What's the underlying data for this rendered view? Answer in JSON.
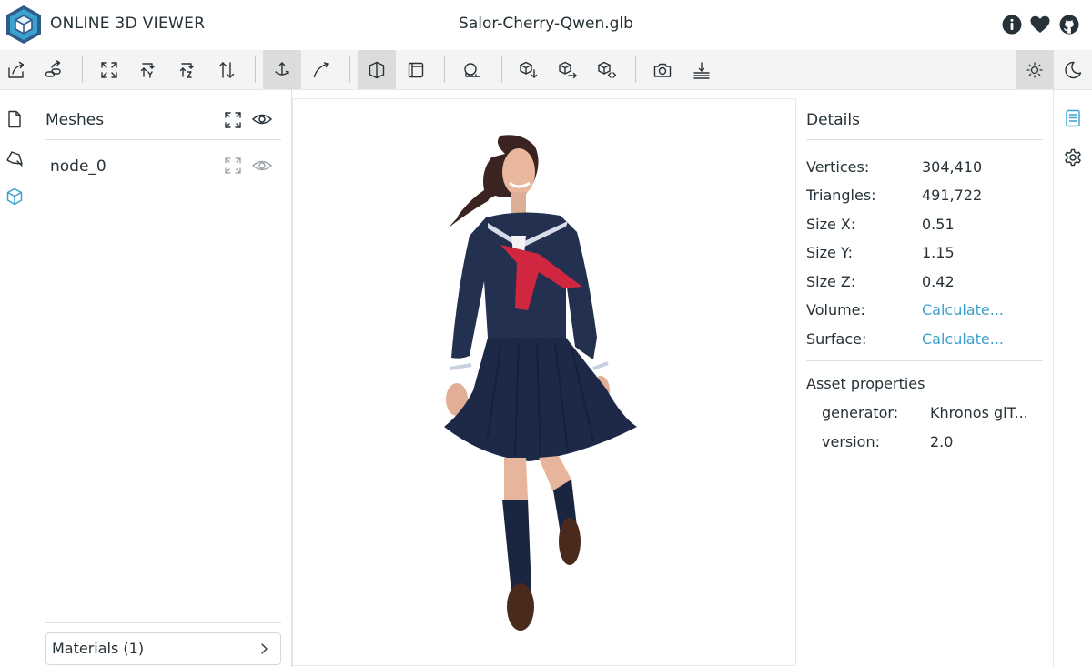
{
  "header": {
    "app_title": "ONLINE 3D VIEWER",
    "file_name": "Salor-Cherry-Qwen.glb",
    "icons": [
      "info-icon",
      "heart-icon",
      "github-icon"
    ]
  },
  "toolbar": {
    "buttons": [
      "open-file",
      "open-url",
      "fit-to-window",
      "set-up-y",
      "set-up-z",
      "flip-up",
      "fixed-up-navigation",
      "free-orbit-navigation",
      "perspective-camera",
      "orthographic-camera",
      "edge-display",
      "export",
      "share",
      "embed",
      "snapshot",
      "measure",
      "light-mode",
      "dark-mode"
    ],
    "selected": [
      "fixed-up-navigation",
      "perspective-camera",
      "light-mode"
    ]
  },
  "left_nav": {
    "icons": [
      "file-icon",
      "navigator-icon",
      "meshes-icon"
    ],
    "active": "meshes-icon"
  },
  "meshes": {
    "title": "Meshes",
    "items": [
      {
        "name": "node_0"
      }
    ],
    "materials_label": "Materials (1)"
  },
  "details": {
    "title": "Details",
    "properties": [
      {
        "label": "Vertices:",
        "value": "304,410"
      },
      {
        "label": "Triangles:",
        "value": "491,722"
      },
      {
        "label": "Size X:",
        "value": "0.51"
      },
      {
        "label": "Size Y:",
        "value": "1.15"
      },
      {
        "label": "Size Z:",
        "value": "0.42"
      },
      {
        "label": "Volume:",
        "value": "Calculate..."
      },
      {
        "label": "Surface:",
        "value": "Calculate..."
      }
    ],
    "asset_title": "Asset properties",
    "asset_properties": [
      {
        "key": "generator:",
        "value": "Khronos glT..."
      },
      {
        "key": "version:",
        "value": "2.0"
      }
    ]
  },
  "right_nav": {
    "icons": [
      "details-icon",
      "settings-icon"
    ]
  },
  "colors": {
    "accent": "#3ca0cf",
    "text": "#263238",
    "toolbar_bg": "#f4f4f4",
    "selected_bg": "#dcdcdc"
  }
}
